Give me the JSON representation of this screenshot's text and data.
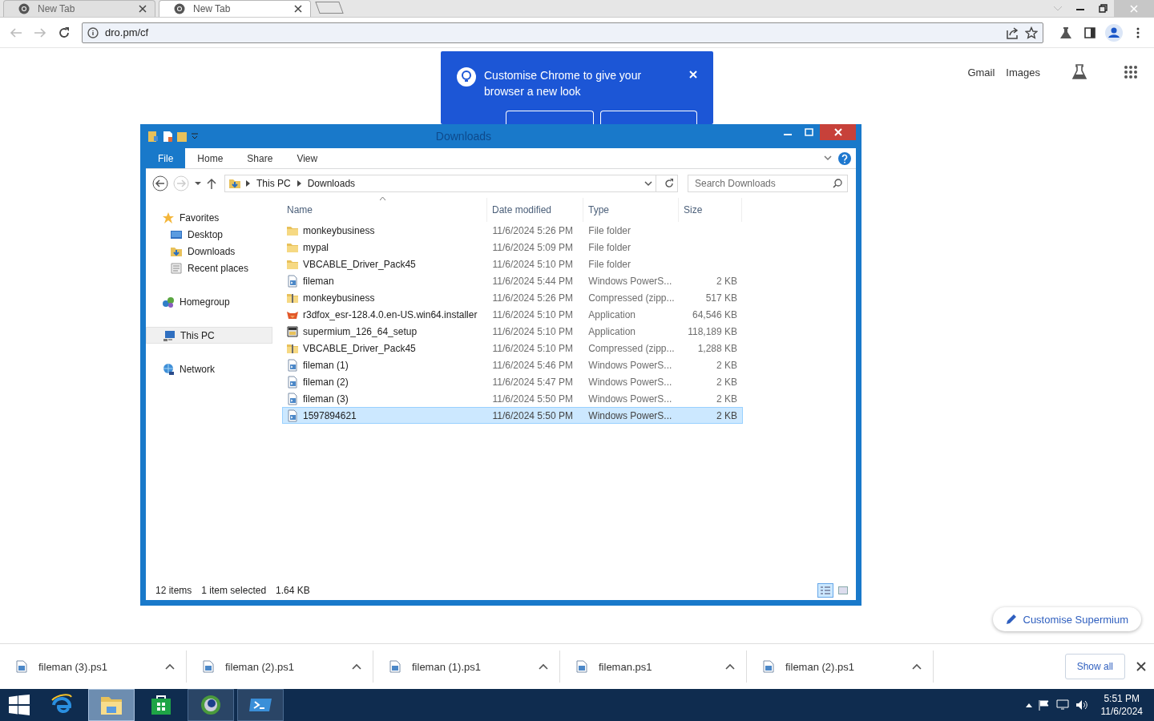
{
  "browser": {
    "tabs": [
      {
        "title": "New Tab",
        "selected": false
      },
      {
        "title": "New Tab",
        "selected": true
      }
    ],
    "address": "dro.pm/cf"
  },
  "promo": {
    "text": "Customise Chrome to give your browser a new look"
  },
  "top_links": [
    "Gmail",
    "Images"
  ],
  "explorer": {
    "title": "Downloads",
    "ribbon_tabs": [
      {
        "label": "File",
        "kind": "file",
        "selected": false
      },
      {
        "label": "Home",
        "kind": "tab",
        "selected": false
      },
      {
        "label": "Share",
        "kind": "tab",
        "selected": false
      },
      {
        "label": "View",
        "kind": "tab",
        "selected": false
      }
    ],
    "breadcrumb": [
      "This PC",
      "Downloads"
    ],
    "search": {
      "placeholder": "Search Downloads"
    },
    "nav": [
      {
        "label": "Favorites",
        "selected": false,
        "children": [
          {
            "label": "Desktop",
            "selected": false
          },
          {
            "label": "Downloads",
            "selected": false
          },
          {
            "label": "Recent places",
            "selected": false
          }
        ]
      },
      {
        "label": "Homegroup",
        "selected": false
      },
      {
        "label": "This PC",
        "selected": true
      },
      {
        "label": "Network",
        "selected": false
      }
    ],
    "columns": [
      "Name",
      "Date modified",
      "Type",
      "Size"
    ],
    "rows": [
      {
        "name": "monkeybusiness",
        "date": "11/6/2024 5:26 PM",
        "type": "File folder",
        "kind": "folder",
        "selected": false
      },
      {
        "name": "mypal",
        "date": "11/6/2024 5:09 PM",
        "type": "File folder",
        "kind": "folder",
        "selected": false
      },
      {
        "name": "VBCABLE_Driver_Pack45",
        "date": "11/6/2024 5:10 PM",
        "type": "File folder",
        "kind": "folder",
        "selected": false
      },
      {
        "name": "fileman",
        "date": "11/6/2024 5:44 PM",
        "type": "Windows PowerS...",
        "size": "2 KB",
        "kind": "script",
        "selected": false
      },
      {
        "name": "monkeybusiness",
        "date": "11/6/2024 5:26 PM",
        "type": "Compressed (zipp...",
        "size": "517 KB",
        "kind": "zip",
        "selected": false
      },
      {
        "name": "r3dfox_esr-128.4.0.en-US.win64.installer",
        "date": "11/6/2024 5:10 PM",
        "type": "Application",
        "size": "64,546 KB",
        "kind": "fox",
        "selected": false
      },
      {
        "name": "supermium_126_64_setup",
        "date": "11/6/2024 5:10 PM",
        "type": "Application",
        "size": "118,189 KB",
        "kind": "setup",
        "selected": false
      },
      {
        "name": "VBCABLE_Driver_Pack45",
        "date": "11/6/2024 5:10 PM",
        "type": "Compressed (zipp...",
        "size": "1,288 KB",
        "kind": "zip",
        "selected": false
      },
      {
        "name": "fileman (1)",
        "date": "11/6/2024 5:46 PM",
        "type": "Windows PowerS...",
        "size": "2 KB",
        "kind": "script",
        "selected": false
      },
      {
        "name": "fileman (2)",
        "date": "11/6/2024 5:47 PM",
        "type": "Windows PowerS...",
        "size": "2 KB",
        "kind": "script",
        "selected": false
      },
      {
        "name": "fileman (3)",
        "date": "11/6/2024 5:50 PM",
        "type": "Windows PowerS...",
        "size": "2 KB",
        "kind": "script",
        "selected": false
      },
      {
        "name": "1597894621",
        "date": "11/6/2024 5:50 PM",
        "type": "Windows PowerS...",
        "size": "2 KB",
        "kind": "script",
        "selected": true
      }
    ],
    "status": {
      "count": "12 items",
      "selection": "1 item selected",
      "size": "1.64 KB"
    }
  },
  "customise_button": "Customise Supermium",
  "downloads": {
    "items": [
      "fileman (3).ps1",
      "fileman (2).ps1",
      "fileman (1).ps1",
      "fileman.ps1",
      "fileman (2).ps1"
    ],
    "show_all": "Show all"
  },
  "taskbar": {
    "apps": [
      {
        "kind": "browser-e",
        "running": false,
        "selected": false
      },
      {
        "kind": "folder",
        "running": true,
        "selected": true
      },
      {
        "kind": "store",
        "running": false,
        "selected": false
      },
      {
        "kind": "globe",
        "running": true,
        "selected": false
      },
      {
        "kind": "terminal",
        "running": true,
        "selected": false
      }
    ],
    "time": "5:51 PM",
    "date": "11/6/2024"
  }
}
